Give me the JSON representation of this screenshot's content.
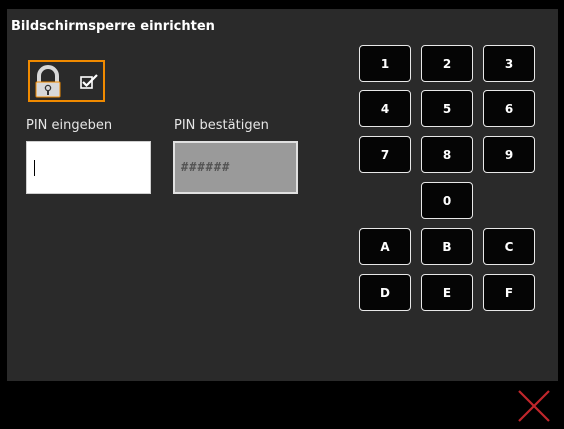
{
  "dialog": {
    "title": "Bildschirmsperre einrichten"
  },
  "lock_toggle": {
    "icons": [
      "padlock-icon",
      "checkbox-checked-icon"
    ],
    "accent_color": "#f08a00",
    "checked": true
  },
  "pin_entry": {
    "label": "PIN eingeben",
    "value": ""
  },
  "pin_confirm": {
    "label": "PIN bestätigen",
    "value": "######"
  },
  "keypad": {
    "keys": [
      "1",
      "2",
      "3",
      "4",
      "5",
      "6",
      "7",
      "8",
      "9",
      "0",
      "A",
      "B",
      "C",
      "D",
      "E",
      "F"
    ]
  },
  "footer": {
    "close_icon": "close-x-icon",
    "close_color": "#c0262b"
  }
}
